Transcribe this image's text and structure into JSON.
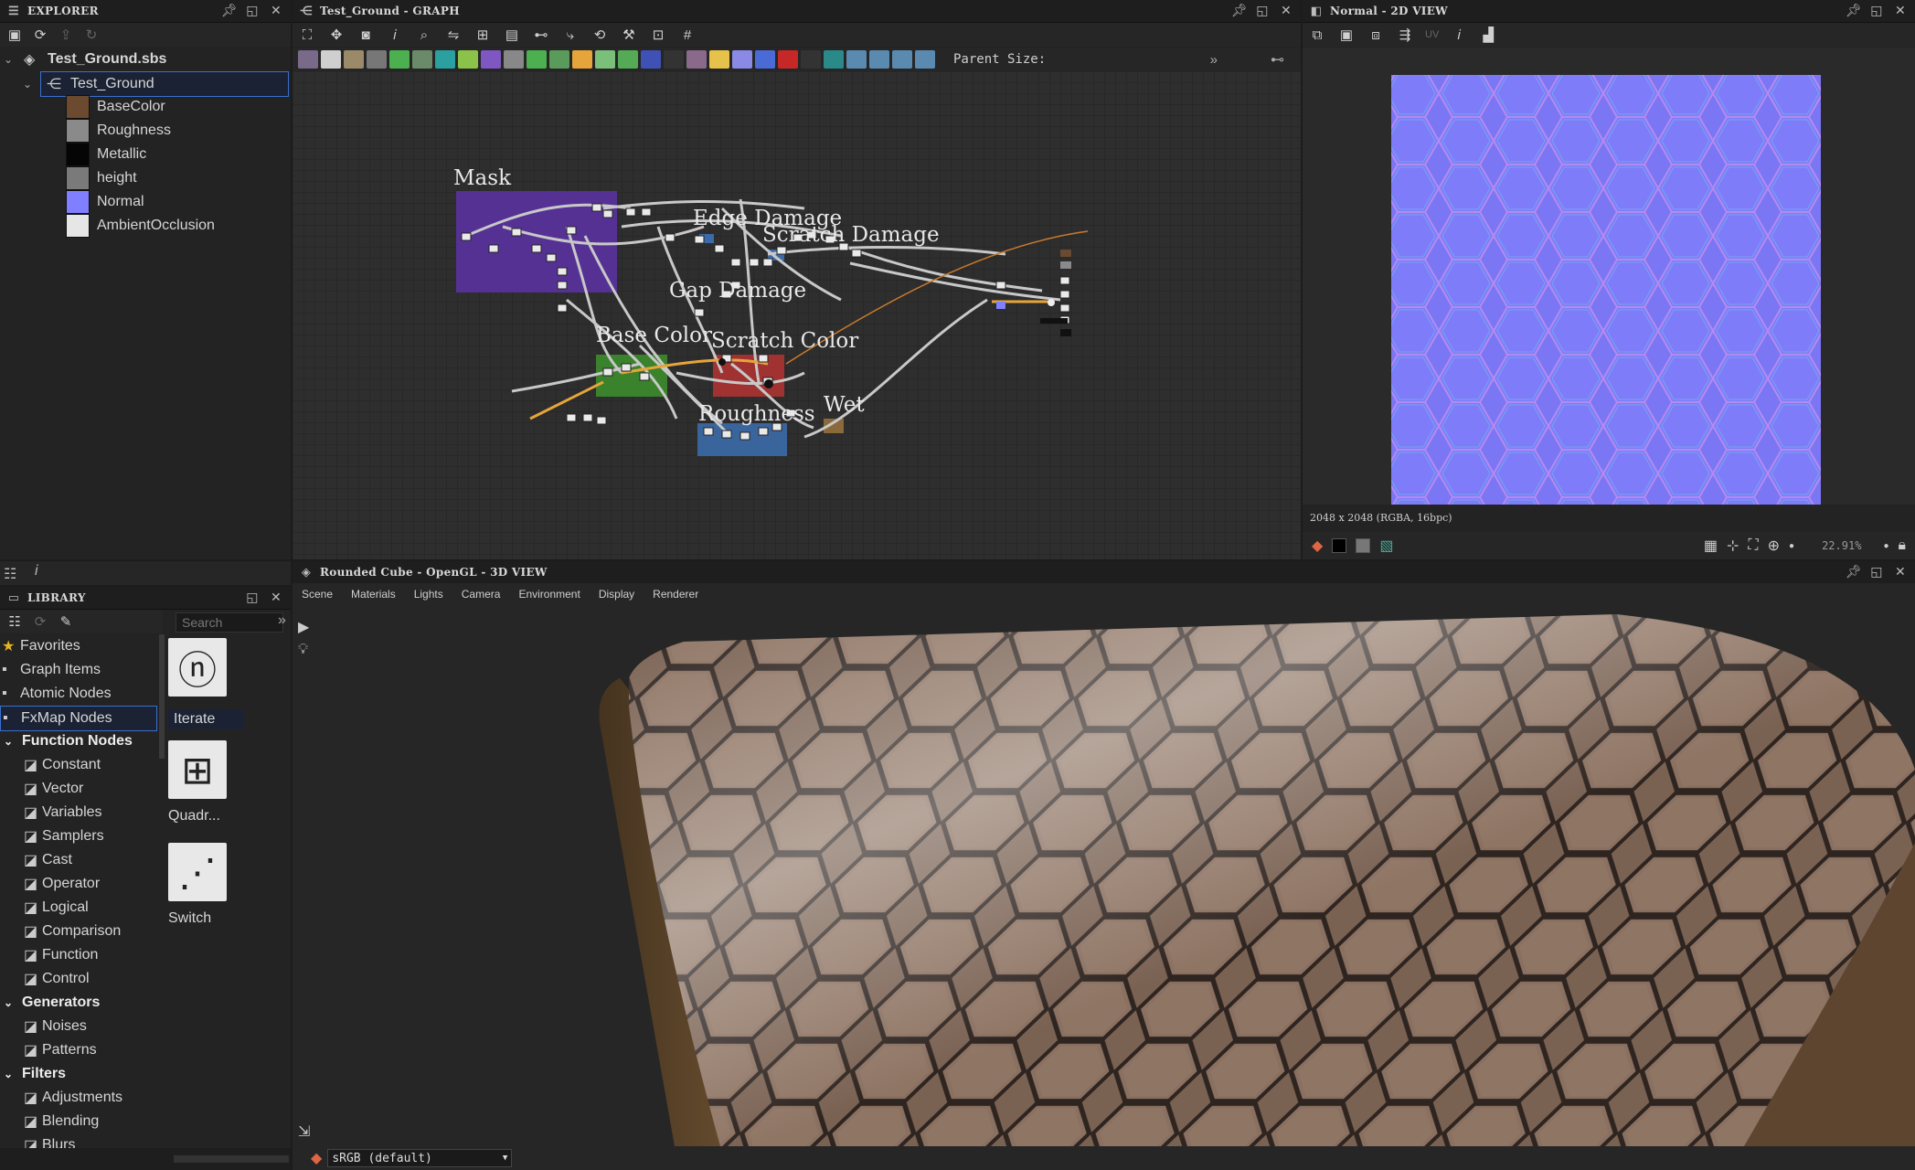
{
  "explorer": {
    "title": "EXPLORER",
    "package": "Test_Ground.sbs",
    "graph": "Test_Ground",
    "outputs": [
      {
        "label": "BaseColor",
        "color": "#6b4a2f"
      },
      {
        "label": "Roughness",
        "color": "#8a8a8a"
      },
      {
        "label": "Metallic",
        "color": "#050505"
      },
      {
        "label": "height",
        "color": "#7a7a7a"
      },
      {
        "label": "Normal",
        "color": "#7f7fff"
      },
      {
        "label": "AmbientOcclusion",
        "color": "#e6e6e6"
      }
    ]
  },
  "graph": {
    "title": "Test_Ground - GRAPH",
    "parent_size_label": "Parent Size:",
    "frames": {
      "mask": "Mask",
      "edge_damage": "Edge Damage",
      "scratch_damage": "Scratch Damage",
      "gap_damage": "Gap Damage",
      "base_color": "Base Color",
      "scratch_color": "Scratch Color",
      "wet": "Wet",
      "roughness": "Roughness"
    }
  },
  "view2d": {
    "title": "Normal - 2D VIEW",
    "uv_label": "UV",
    "info": "2048 x 2048 (RGBA, 16bpc)",
    "zoom": "22.91%"
  },
  "library": {
    "title": "LIBRARY",
    "search_placeholder": "Search",
    "items": [
      {
        "label": "Favorites",
        "type": "top",
        "icon": "star-icon"
      },
      {
        "label": "Graph Items",
        "type": "top",
        "icon": "graph-items-icon"
      },
      {
        "label": "Atomic Nodes",
        "type": "top",
        "icon": "atomic-nodes-icon"
      },
      {
        "label": "FxMap Nodes",
        "type": "top",
        "icon": "fxmap-icon"
      },
      {
        "label": "Function Nodes",
        "type": "cat"
      },
      {
        "label": "Constant",
        "type": "sub"
      },
      {
        "label": "Vector",
        "type": "sub"
      },
      {
        "label": "Variables",
        "type": "sub"
      },
      {
        "label": "Samplers",
        "type": "sub"
      },
      {
        "label": "Cast",
        "type": "sub"
      },
      {
        "label": "Operator",
        "type": "sub"
      },
      {
        "label": "Logical",
        "type": "sub"
      },
      {
        "label": "Comparison",
        "type": "sub"
      },
      {
        "label": "Function",
        "type": "sub"
      },
      {
        "label": "Control",
        "type": "sub"
      },
      {
        "label": "Generators",
        "type": "cat"
      },
      {
        "label": "Noises",
        "type": "sub"
      },
      {
        "label": "Patterns",
        "type": "sub"
      },
      {
        "label": "Filters",
        "type": "cat"
      },
      {
        "label": "Adjustments",
        "type": "sub"
      },
      {
        "label": "Blending",
        "type": "sub"
      },
      {
        "label": "Blurs",
        "type": "sub"
      }
    ],
    "tiles": [
      {
        "label": "Iterate",
        "icon": "iterate-icon"
      },
      {
        "label": "Quadr...",
        "icon": "quadrant-icon"
      },
      {
        "label": "Switch",
        "icon": "switch-icon"
      }
    ]
  },
  "view3d": {
    "title": "Rounded Cube - OpenGL - 3D VIEW",
    "menu": [
      "Scene",
      "Materials",
      "Lights",
      "Camera",
      "Environment",
      "Display",
      "Renderer"
    ],
    "colorspace": "sRGB (default)"
  }
}
